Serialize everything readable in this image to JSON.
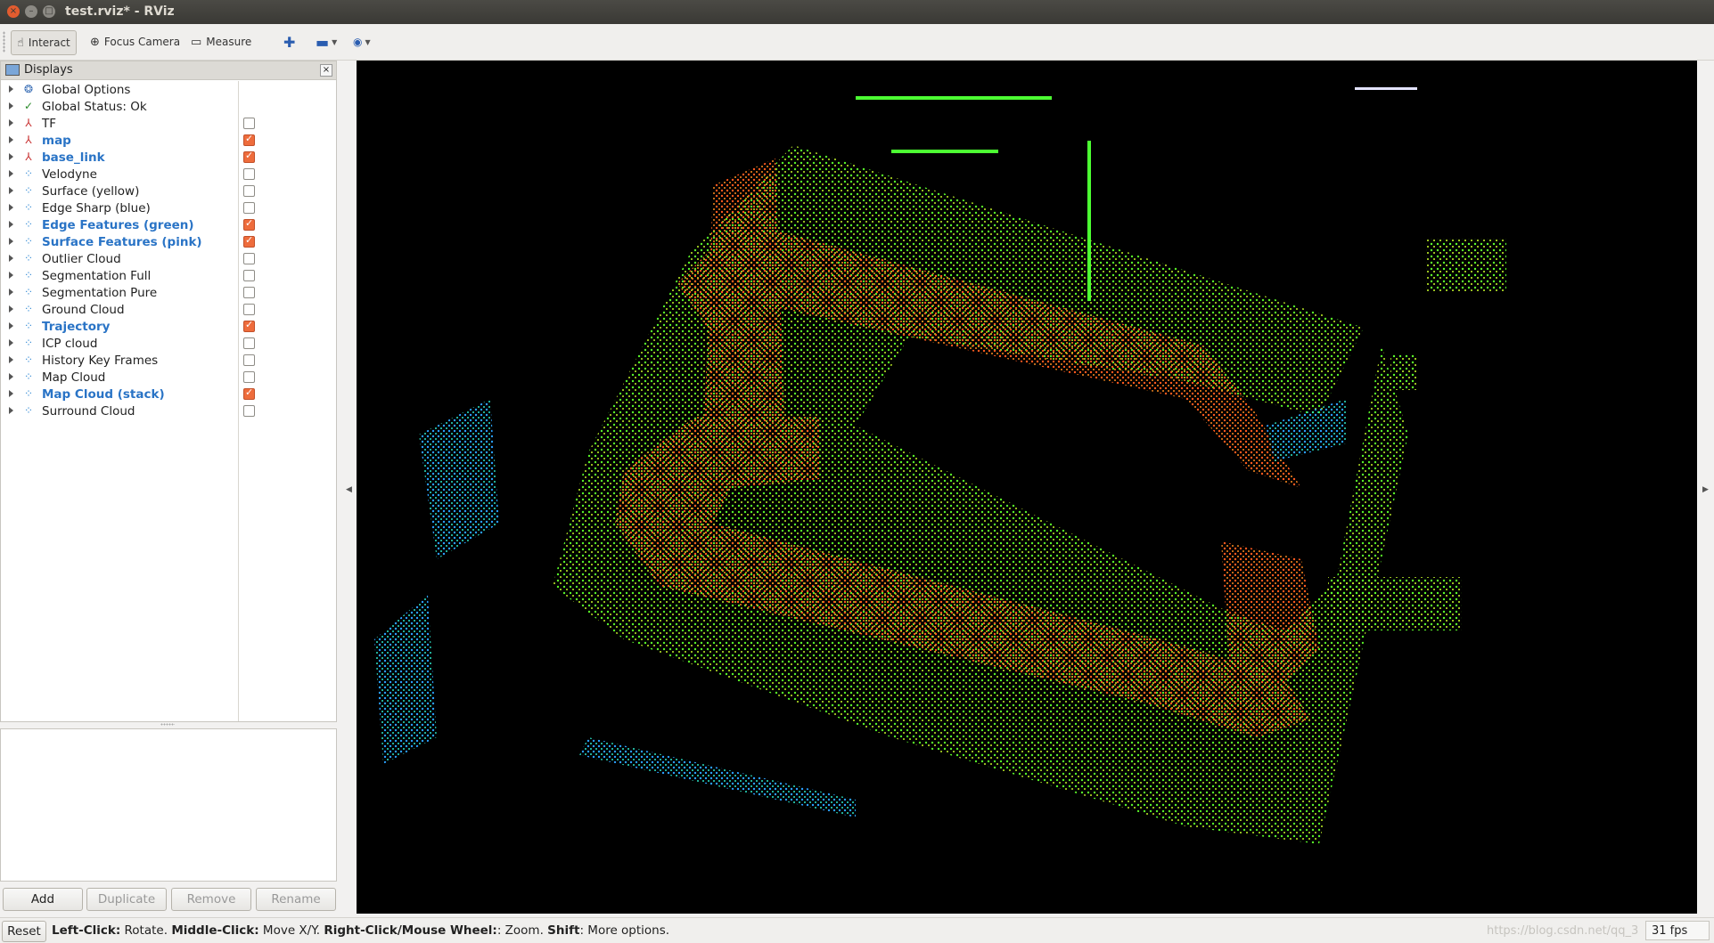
{
  "window": {
    "title": "test.rviz* - RViz"
  },
  "toolbar": {
    "interact": "Interact",
    "focus_camera": "Focus Camera",
    "measure": "Measure",
    "add_icon": "plus-icon",
    "remove_icon": "minus-icon",
    "view_icon": "eye-icon"
  },
  "panel": {
    "title": "Displays",
    "items": [
      {
        "label": "Global Options",
        "icon": "globe-icon",
        "checkbox": null
      },
      {
        "label": "Global Status: Ok",
        "icon": "check-icon",
        "checkbox": null
      },
      {
        "label": "TF",
        "icon": "axes-icon",
        "checkbox": false
      },
      {
        "label": "map",
        "icon": "axes-icon",
        "checkbox": true
      },
      {
        "label": "base_link",
        "icon": "axes-icon",
        "checkbox": true
      },
      {
        "label": "Velodyne",
        "icon": "pointcloud-icon",
        "checkbox": false
      },
      {
        "label": "Surface (yellow)",
        "icon": "pointcloud-icon",
        "checkbox": false
      },
      {
        "label": "Edge Sharp (blue)",
        "icon": "pointcloud-icon",
        "checkbox": false
      },
      {
        "label": "Edge Features (green)",
        "icon": "pointcloud-icon",
        "checkbox": true
      },
      {
        "label": "Surface Features (pink)",
        "icon": "pointcloud-icon",
        "checkbox": true
      },
      {
        "label": "Outlier Cloud",
        "icon": "pointcloud-icon",
        "checkbox": false
      },
      {
        "label": "Segmentation Full",
        "icon": "pointcloud-icon",
        "checkbox": false
      },
      {
        "label": "Segmentation Pure",
        "icon": "pointcloud-icon",
        "checkbox": false
      },
      {
        "label": "Ground Cloud",
        "icon": "pointcloud-icon",
        "checkbox": false
      },
      {
        "label": "Trajectory",
        "icon": "pointcloud-icon",
        "checkbox": true
      },
      {
        "label": "ICP cloud",
        "icon": "pointcloud-icon",
        "checkbox": false
      },
      {
        "label": "History Key Frames",
        "icon": "pointcloud-icon",
        "checkbox": false
      },
      {
        "label": "Map Cloud",
        "icon": "pointcloud-icon",
        "checkbox": false
      },
      {
        "label": "Map Cloud (stack)",
        "icon": "pointcloud-icon",
        "checkbox": true
      },
      {
        "label": "Surround Cloud",
        "icon": "pointcloud-icon",
        "checkbox": false
      }
    ],
    "buttons": {
      "add": "Add",
      "duplicate": "Duplicate",
      "remove": "Remove",
      "rename": "Rename"
    }
  },
  "status": {
    "reset": "Reset",
    "left_click": "Left-Click:",
    "left_desc": " Rotate. ",
    "middle_click": "Middle-Click:",
    "middle_desc": " Move X/Y. ",
    "right_click": "Right-Click/Mouse Wheel:",
    "right_desc": ": Zoom. ",
    "shift": "Shift",
    "shift_desc": ": More options.",
    "watermark": "https://blog.csdn.net/qq_3",
    "fps": "31 fps"
  },
  "colors": {
    "enabled_label": "#2a74c6",
    "checkbox_on": "#ee6c3c",
    "viewport_bg": "#000000"
  }
}
